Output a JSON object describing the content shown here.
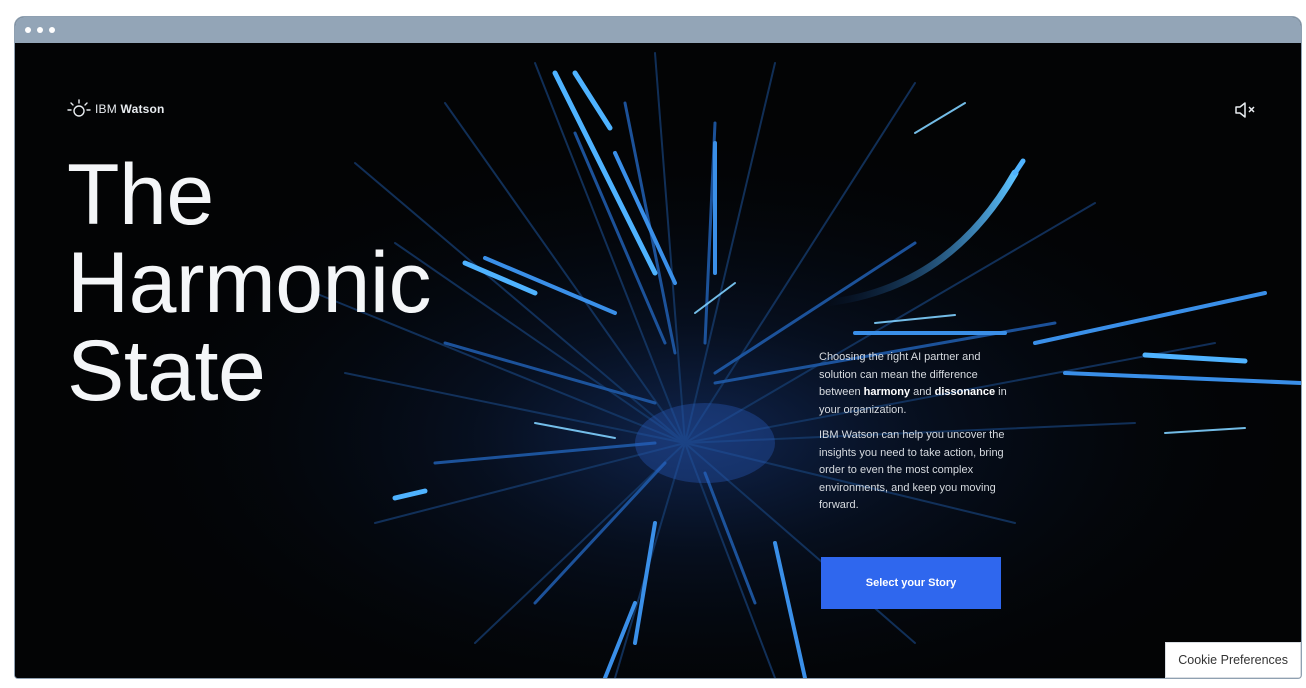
{
  "window": {
    "controls": [
      "dot",
      "dot",
      "dot"
    ]
  },
  "brand": {
    "logo_icon": "watson-avatar-icon",
    "prefix": "IBM",
    "name": "Watson"
  },
  "header": {
    "mute_icon": "speaker-muted-icon"
  },
  "hero": {
    "headline": [
      "The",
      "Harmonic",
      "State"
    ],
    "paragraph1": {
      "before": "Choosing the right AI partner and solution can mean the difference between ",
      "word1": "harmony",
      "mid": " and ",
      "word2": "dissonance",
      "after": " in your organization."
    },
    "paragraph2": "IBM Watson can help you uncover the insights you need to take action, bring order to even the most complex environments, and keep you moving forward.",
    "cta_label": "Select your Story"
  },
  "footer": {
    "cookie_label": "Cookie Preferences"
  },
  "colors": {
    "accent": "#2f67ee",
    "background": "#030405",
    "streak": "#4fb3ff"
  }
}
